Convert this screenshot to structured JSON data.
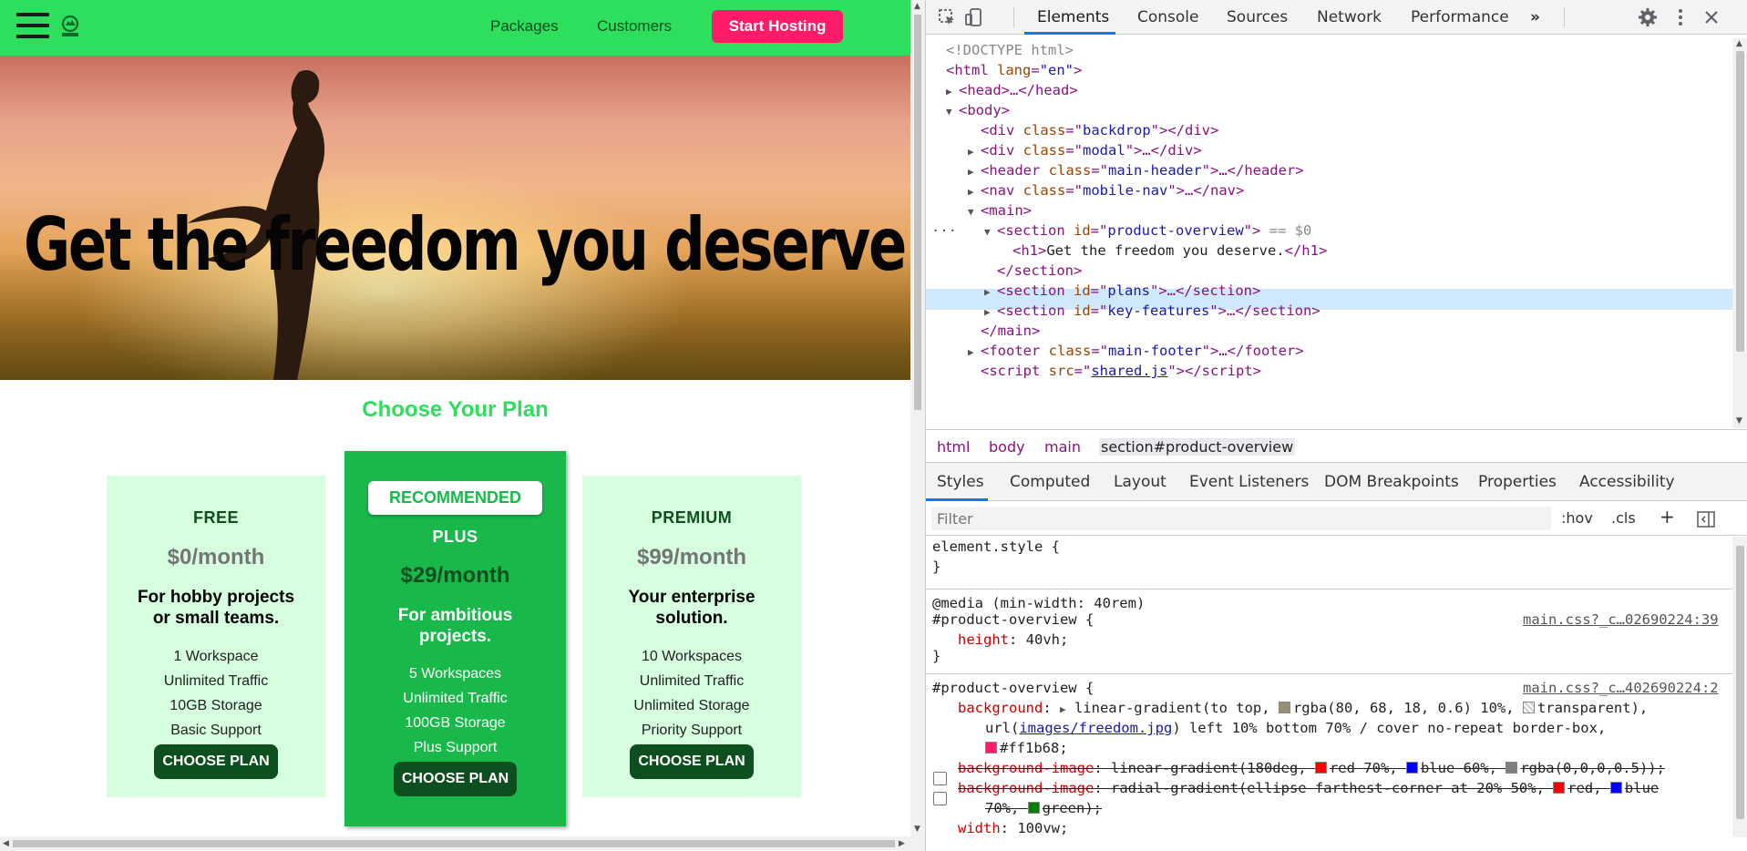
{
  "site": {
    "nav": {
      "packages": "Packages",
      "customers": "Customers",
      "cta": "Start Hosting"
    },
    "hero_title": "Get the freedom you deserve.",
    "plans_title": "Choose Your Plan",
    "plans": [
      {
        "name": "FREE",
        "price": "$0/month",
        "desc": "For hobby projects or small teams.",
        "features": [
          "1 Workspace",
          "Unlimited Traffic",
          "10GB Storage",
          "Basic Support"
        ],
        "button": "CHOOSE PLAN"
      },
      {
        "badge": "RECOMMENDED",
        "name": "PLUS",
        "price": "$29/month",
        "desc": "For ambitious projects.",
        "features": [
          "5 Workspaces",
          "Unlimited Traffic",
          "100GB Storage",
          "Plus Support"
        ],
        "button": "CHOOSE PLAN"
      },
      {
        "name": "PREMIUM",
        "price": "$99/month",
        "desc": "Your enterprise solution.",
        "features": [
          "10 Workspaces",
          "Unlimited Traffic",
          "Unlimited Storage",
          "Priority Support"
        ],
        "button": "CHOOSE PLAN"
      }
    ],
    "colors": {
      "header": "#2ddf5c",
      "cta": "#ff1b68",
      "plan_bg": "#d5ffde",
      "plan_highlight": "#19b84b",
      "button": "#0e4f1f"
    }
  },
  "devtools": {
    "tabs": [
      "Elements",
      "Console",
      "Sources",
      "Network",
      "Performance"
    ],
    "more_tabs": "»",
    "dom": {
      "doctype": "<!DOCTYPE html>",
      "html_tag": "<html",
      "lang_attr": "lang",
      "lang_val": "\"en\"",
      "head": "<head>…</head>",
      "body": "<body>",
      "backdrop": "backdrop",
      "modal": "modal",
      "header": "main-header",
      "nav": "mobile-nav",
      "main": "<main>",
      "section1_id": "product-overview",
      "eq_marker": "== $0",
      "h1_text": "Get the freedom you deserve.",
      "section_close": "</section>",
      "section2_id": "plans",
      "section3_id": "key-features",
      "main_close": "</main>",
      "footer": "main-footer",
      "script_src": "shared.js"
    },
    "breadcrumbs": [
      "html",
      "body",
      "main",
      "section#product-overview"
    ],
    "styles_tabs": [
      "Styles",
      "Computed",
      "Layout",
      "Event Listeners",
      "DOM Breakpoints",
      "Properties",
      "Accessibility"
    ],
    "filter_placeholder": "Filter",
    "hov": ":hov",
    "cls": ".cls",
    "rules": {
      "element_style": "element.style {",
      "close": "}",
      "media": "@media (min-width: 40rem)",
      "selector": "#product-overview {",
      "src1": "main.css?_c…02690224:39",
      "height_prop": "height",
      "height_val": "40vh;",
      "src2": "main.css?_c…402690224:2",
      "bg_prop": "background",
      "bg_val1": "linear-gradient(to top,",
      "bg_rgba": "rgba(80, 68, 18, 0.6) 10%,",
      "bg_transparent": "transparent),",
      "bg_url_pre": "url(",
      "bg_url": "images/freedom.jpg",
      "bg_url_post": ") left 10% bottom 70% / cover no-repeat border-box,",
      "bg_color": "#ff1b68;",
      "bgi1_prop": "background-image",
      "bgi1_a": "linear-gradient(180deg,",
      "bgi1_red": "red 70%,",
      "bgi1_blue": "blue 60%,",
      "bgi1_rgba": "rgba(0,0,0,0.5));",
      "bgi2_prop": "background-image",
      "bgi2_a": "radial-gradient(ellipse farthest-corner at 20% 50%,",
      "bgi2_red": "red,",
      "bgi2_blue": "blue",
      "bgi2_b": "70%,",
      "bgi2_green": "green);",
      "width_prop": "width",
      "width_val": "100vw;"
    }
  }
}
